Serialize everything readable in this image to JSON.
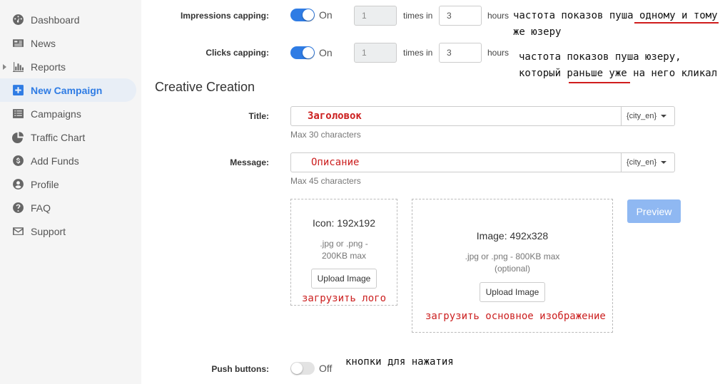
{
  "sidebar": {
    "items": [
      {
        "label": "Dashboard",
        "icon": "dashboard-icon"
      },
      {
        "label": "News",
        "icon": "news-icon"
      },
      {
        "label": "Reports",
        "icon": "reports-icon"
      },
      {
        "label": "New Campaign",
        "icon": "plus-square-icon"
      },
      {
        "label": "Campaigns",
        "icon": "list-icon"
      },
      {
        "label": "Traffic Chart",
        "icon": "pie-chart-icon"
      },
      {
        "label": "Add Funds",
        "icon": "money-icon"
      },
      {
        "label": "Profile",
        "icon": "user-icon"
      },
      {
        "label": "FAQ",
        "icon": "question-icon"
      },
      {
        "label": "Support",
        "icon": "envelope-icon"
      }
    ],
    "active": "New Campaign"
  },
  "capping": {
    "impressions_label": "Impressions capping:",
    "impressions_state": "On",
    "impressions_times": "1",
    "impressions_hours": "3",
    "clicks_label": "Clicks capping:",
    "clicks_state": "On",
    "clicks_times": "1",
    "clicks_hours": "3",
    "times_in": "times in",
    "hours": "hours"
  },
  "creative": {
    "section_title": "Creative Creation",
    "title_label": "Title:",
    "title_value": "Заголовок",
    "title_macro": "{city_en}",
    "title_hint": "Max 30 characters",
    "message_label": "Message:",
    "message_value": "Описание",
    "message_macro": "{city_en}",
    "message_hint": "Max 45 characters",
    "icon_title": "Icon: 192x192",
    "icon_sub1": ".jpg or .png -",
    "icon_sub2": "200KB max",
    "icon_upload": "Upload Image",
    "image_title": "Image: 492x328",
    "image_sub1": ".jpg or .png - 800KB max",
    "image_sub2": "(optional)",
    "image_upload": "Upload Image",
    "preview": "Preview",
    "push_label": "Push buttons:",
    "push_state": "Off"
  },
  "annotations": {
    "impressions_note_1": "частота показов пуша одному и тому",
    "impressions_note_2": "же юзеру",
    "clicks_note_1": "частота показов пуша юзеру,",
    "clicks_note_2": "который раньше уже на него кликал",
    "upload_logo": "загрузить лого",
    "upload_main": "загрузить основное изображение",
    "push_note": "кнопки для нажатия"
  },
  "colors": {
    "accent": "#2f7ce4",
    "annotation_red": "#cc2020"
  }
}
